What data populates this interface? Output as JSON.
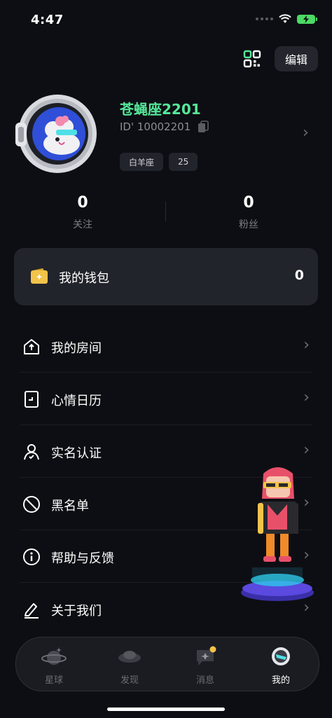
{
  "status_bar": {
    "time": "4:47"
  },
  "header": {
    "edit_label": "编辑"
  },
  "profile": {
    "nickname": "苍蝇座2201",
    "user_id": "ID' 10002201",
    "tags": [
      "白羊座",
      "25"
    ]
  },
  "stats": [
    {
      "value": "0",
      "label": "关注"
    },
    {
      "value": "0",
      "label": "粉丝"
    }
  ],
  "wallet": {
    "label": "我的钱包",
    "value": "0"
  },
  "menu": [
    {
      "label": "我的房间",
      "icon": "home-icon"
    },
    {
      "label": "心情日历",
      "icon": "calendar-icon"
    },
    {
      "label": "实名认证",
      "icon": "verify-person-icon"
    },
    {
      "label": "黑名单",
      "icon": "block-icon"
    },
    {
      "label": "帮助与反馈",
      "icon": "info-icon"
    },
    {
      "label": "关于我们",
      "icon": "pen-icon"
    }
  ],
  "tabbar": [
    {
      "label": "星球",
      "icon": "planet-icon"
    },
    {
      "label": "发现",
      "icon": "discover-icon"
    },
    {
      "label": "消息",
      "icon": "message-icon"
    },
    {
      "label": "我的",
      "icon": "profile-icon",
      "active": true
    }
  ],
  "colors": {
    "nickname": "#55e89a",
    "accent_wallet": "#f3c34a",
    "background": "#0d0e13"
  }
}
